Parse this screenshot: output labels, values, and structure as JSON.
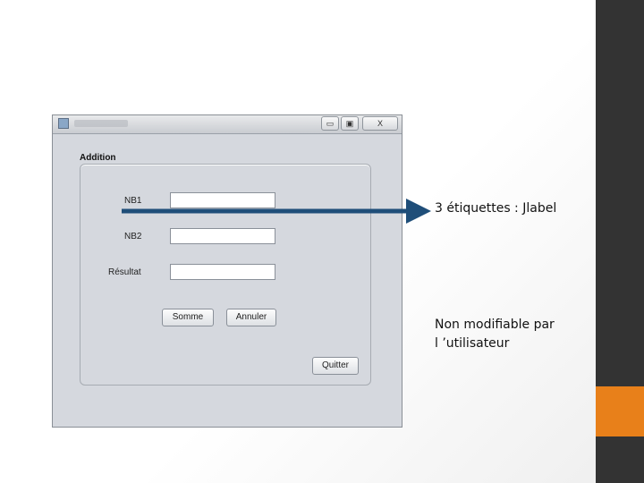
{
  "window": {
    "group_title": "Addition",
    "labels": {
      "nb1": "NB1",
      "nb2": "NB2",
      "result": "Résultat"
    },
    "buttons": {
      "sum": "Somme",
      "cancel": "Annuler",
      "quit": "Quitter"
    },
    "window_buttons": {
      "minimize": "▭",
      "maximize": "▣",
      "close": "X"
    }
  },
  "annotations": {
    "labels_note": "3 étiquettes : Jlabel",
    "readonly_note_line1": "Non modifiable par",
    "readonly_note_line2": "l ’utilisateur"
  },
  "colors": {
    "side_bar": "#333333",
    "accent": "#E8801A",
    "arrow": "#1F4E79"
  }
}
